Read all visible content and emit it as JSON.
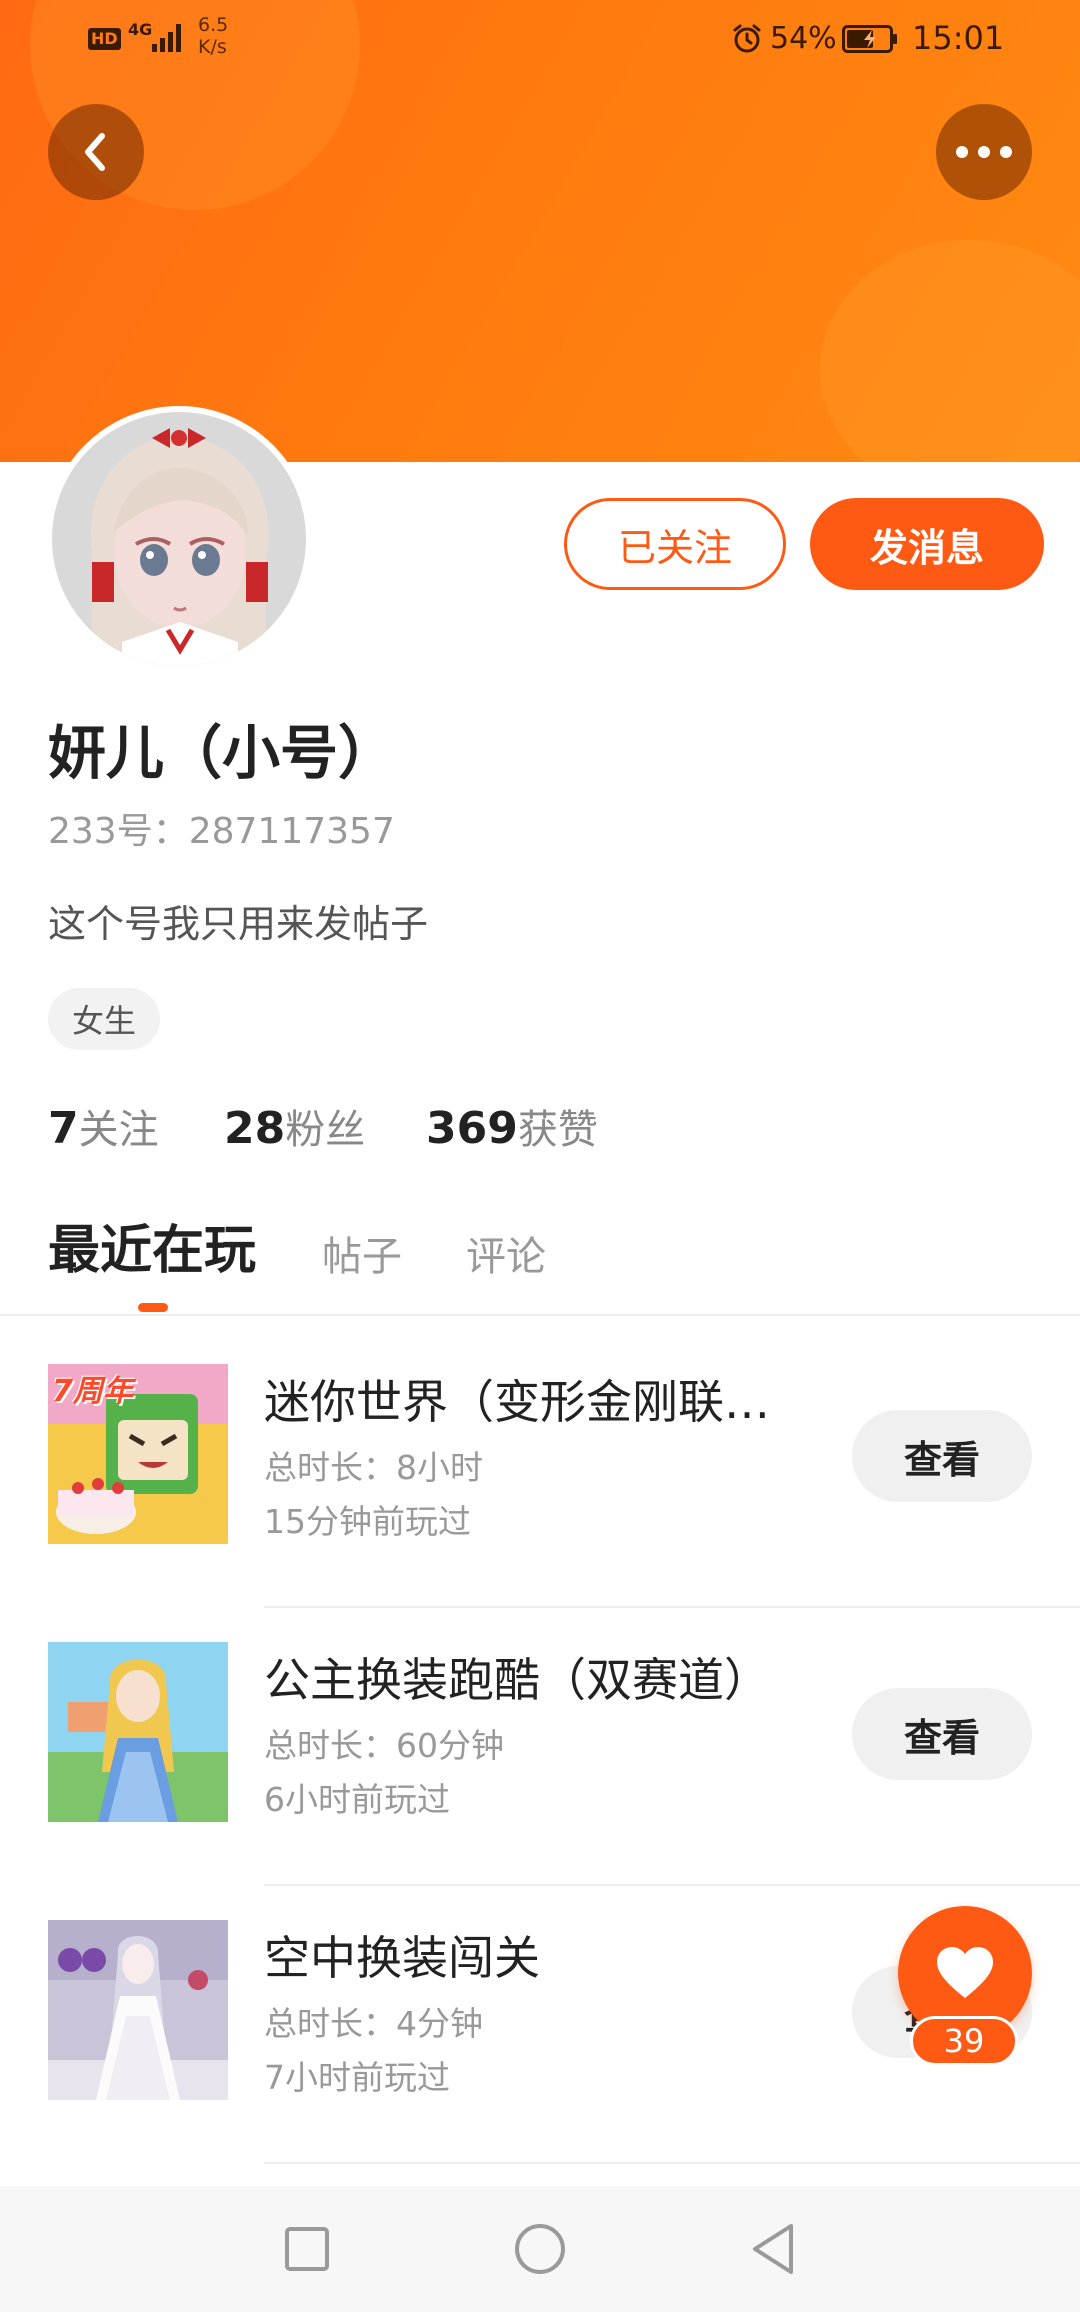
{
  "status_bar": {
    "hd_label": "HD",
    "network_label": "4G",
    "speed_value": "6.5",
    "speed_unit": "K/s",
    "battery_percent": "54%",
    "time": "15:01",
    "icons": [
      "alarm-icon",
      "battery-charging-icon",
      "signal-icon"
    ]
  },
  "header": {
    "back_icon": "chevron-left-icon",
    "more_icon": "more-dots-icon",
    "gradient_start": "#ff6a13",
    "gradient_end": "#ff8a12"
  },
  "profile": {
    "name": "妍儿（小号）",
    "id_text": "233号：287117357",
    "bio": "这个号我只用来发帖子",
    "gender_tag": "女生",
    "follow_button": "已关注",
    "message_button": "发消息",
    "stats": {
      "following_count": "7",
      "following_label": "关注",
      "fans_count": "28",
      "fans_label": "粉丝",
      "likes_count": "369",
      "likes_label": "获赞"
    }
  },
  "tabs": {
    "recent": "最近在玩",
    "posts": "帖子",
    "comments": "评论",
    "active": "recent"
  },
  "games": [
    {
      "title": "迷你世界（变形金刚联…",
      "duration": "总时长：8小时",
      "last_played": "15分钟前玩过",
      "view_label": "查看"
    },
    {
      "title": "公主换装跑酷（双赛道）",
      "duration": "总时长：60分钟",
      "last_played": "6小时前玩过",
      "view_label": "查看"
    },
    {
      "title": "空中换装闯关",
      "duration": "总时长：4分钟",
      "last_played": "7小时前玩过",
      "view_label": "查看"
    }
  ],
  "game_thumb_labels": {
    "first_badge": "7周年"
  },
  "like_fab": {
    "count": "39",
    "icon": "heart-icon"
  },
  "accent_color": "#ff5a14",
  "nav_bar": {
    "icons": [
      "recent-apps-icon",
      "home-icon",
      "back-triangle-icon"
    ]
  }
}
